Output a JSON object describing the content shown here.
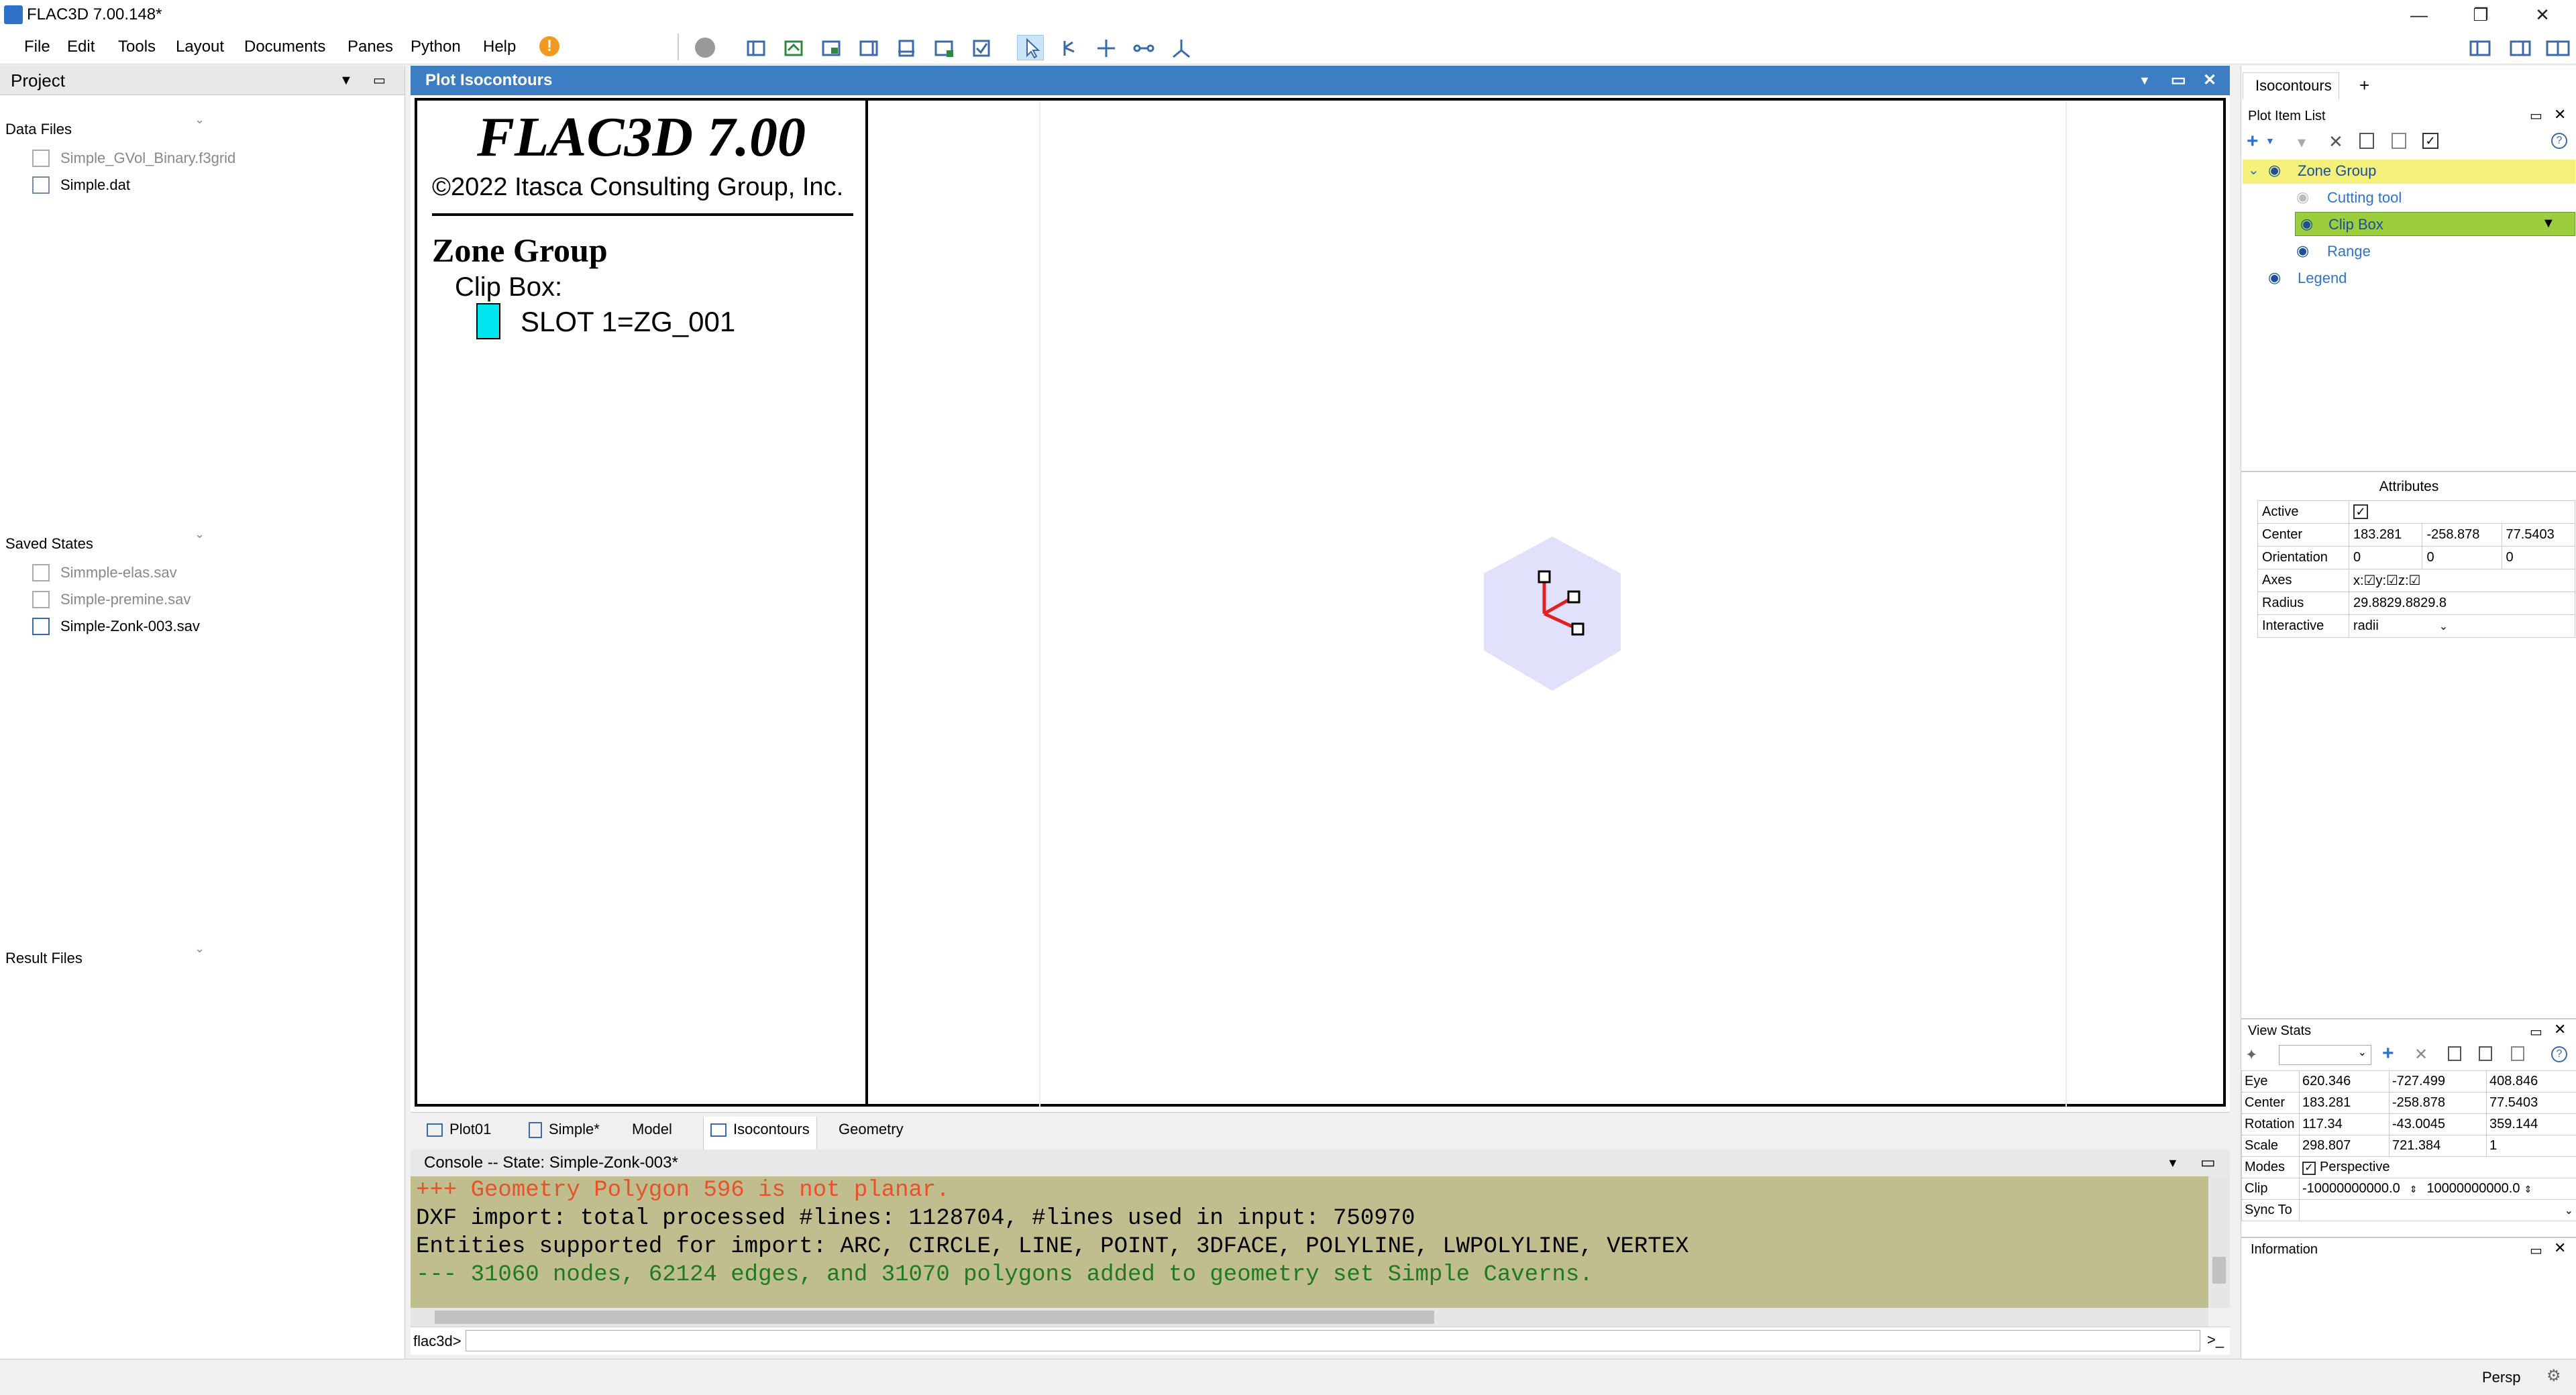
{
  "window": {
    "title": "FLAC3D 7.00.148*"
  },
  "menu": [
    "File",
    "Edit",
    "Tools",
    "Layout",
    "Documents",
    "Panes",
    "Python",
    "Help"
  ],
  "project": {
    "title": "Project",
    "sections": [
      {
        "title": "Data Files",
        "items": [
          {
            "name": "Simple_GVol_Binary.f3grid"
          },
          {
            "name": "Simple.dat"
          }
        ]
      },
      {
        "title": "Saved States",
        "items": [
          {
            "name": "Simmple-elas.sav"
          },
          {
            "name": "Simple-premine.sav"
          },
          {
            "name": "Simple-Zonk-003.sav"
          }
        ]
      },
      {
        "title": "Result Files",
        "items": []
      }
    ]
  },
  "plot": {
    "title": "Plot Isocontours",
    "legend": {
      "app": "FLAC3D 7.00",
      "copyright": "©2022 Itasca Consulting Group, Inc.",
      "heading": "Zone Group",
      "sub": "Clip Box:",
      "entry": "SLOT 1=ZG_001",
      "entry_color": "#00e5ee"
    }
  },
  "tabs": [
    "Plot01",
    "Simple*",
    "Model",
    "Isocontours",
    "Geometry"
  ],
  "console": {
    "header": "Console -- State: Simple-Zonk-003*",
    "lines": [
      {
        "text": "+++ Geometry Polygon 596 is not planar.",
        "color": "#e8522a"
      },
      {
        "text": " DXF import: total processed #lines: 1128704, #lines used in input: 750970",
        "color": "#000000"
      },
      {
        "text": "Entities supported for import: ARC, CIRCLE, LINE, POINT, 3DFACE, POLYLINE, LWPOLYLINE, VERTEX",
        "color": "#000000"
      },
      {
        "text": "--- 31060 nodes, 62124 edges, and 31070 polygons added to geometry set Simple Caverns.",
        "color": "#1f7a1f"
      }
    ],
    "prompt": "flac3d>",
    "run": ">_"
  },
  "right": {
    "tab": "Isocontours",
    "add_tab": "+",
    "plot_item_list": "Plot Item List",
    "tree": {
      "group": "Zone Group",
      "children": [
        "Cutting tool",
        "Clip Box",
        "Range"
      ],
      "legend": "Legend"
    },
    "attributes": {
      "title": "Attributes",
      "active_label": "Active",
      "center_label": "Center",
      "center": [
        "183.281",
        "-258.878",
        "77.5403"
      ],
      "orientation_label": "Orientation",
      "orientation": [
        "0",
        "0",
        "0"
      ],
      "axes_label": "Axes",
      "axes": "x:☑y:☑z:☑",
      "radius_label": "Radius",
      "radius": "29.8829.8829.8",
      "interactive_label": "Interactive",
      "interactive": "radii"
    },
    "viewstats": {
      "title": "View Stats",
      "rows": [
        {
          "label": "Eye",
          "v": [
            "620.346",
            "-727.499",
            "408.846"
          ]
        },
        {
          "label": "Center",
          "v": [
            "183.281",
            "-258.878",
            "77.5403"
          ]
        },
        {
          "label": "Rotation",
          "v": [
            "117.34",
            "-43.0045",
            "359.144"
          ]
        },
        {
          "label": "Scale",
          "v": [
            "298.807",
            "721.384",
            "1"
          ]
        }
      ],
      "modes_label": "Modes",
      "perspective": "Perspective",
      "clip_label": "Clip",
      "clip": [
        "-10000000000.0",
        "10000000000.0"
      ],
      "syncto_label": "Sync To"
    },
    "information": "Information"
  },
  "status": {
    "mode": "Persp"
  },
  "colors": {
    "accent": "#3c7dc4",
    "highlight": "#f5f07a",
    "console_bg": "#c0bd8e",
    "clipbox_fill": "#e1e1fb"
  }
}
